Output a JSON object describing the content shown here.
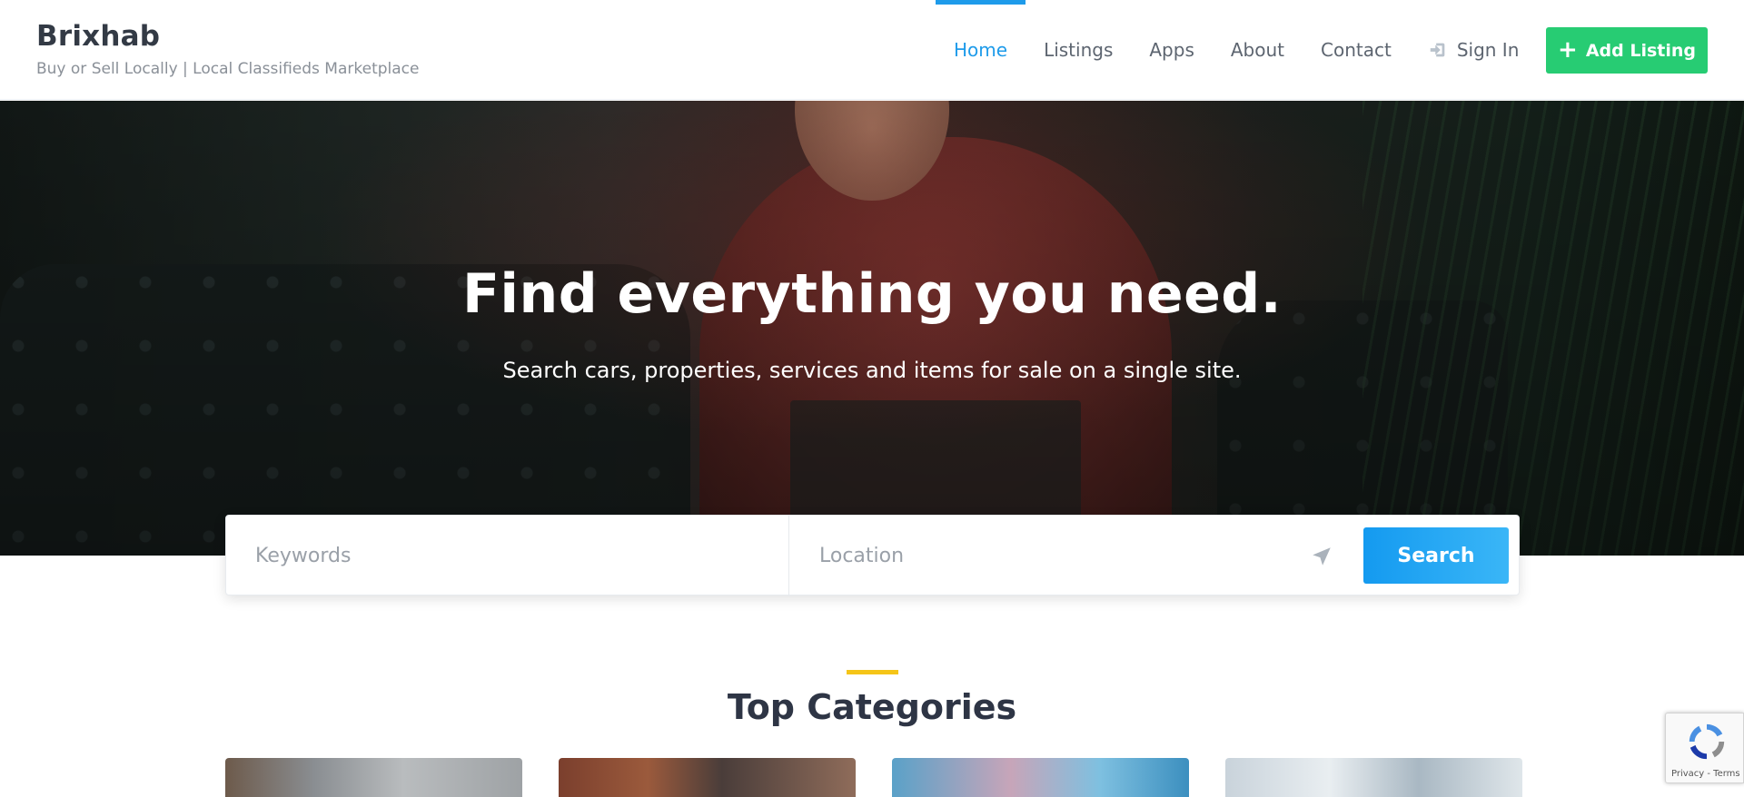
{
  "brand": {
    "title": "Brixhab",
    "tagline": "Buy or Sell Locally | Local Classifieds Marketplace"
  },
  "nav": {
    "items": [
      {
        "label": "Home",
        "active": true
      },
      {
        "label": "Listings",
        "active": false
      },
      {
        "label": "Apps",
        "active": false
      },
      {
        "label": "About",
        "active": false
      },
      {
        "label": "Contact",
        "active": false
      }
    ],
    "signin_label": "Sign In",
    "signin_icon": "sign-in-icon",
    "add_listing_label": "Add Listing",
    "add_listing_icon": "plus-icon"
  },
  "hero": {
    "title": "Find everything you need.",
    "subtitle": "Search cars, properties, services and items for sale on a single site."
  },
  "search": {
    "keywords_placeholder": "Keywords",
    "keywords_value": "",
    "location_placeholder": "Location",
    "location_value": "",
    "locate_icon": "location-arrow-icon",
    "button_label": "Search"
  },
  "categories": {
    "title": "Top Categories"
  },
  "recaptcha": {
    "terms": "Privacy - Terms"
  },
  "colors": {
    "accent_blue": "#1e9bea",
    "add_listing_green": "#27cc73",
    "section_accent_yellow": "#f5c518",
    "search_button": "#149af0"
  }
}
